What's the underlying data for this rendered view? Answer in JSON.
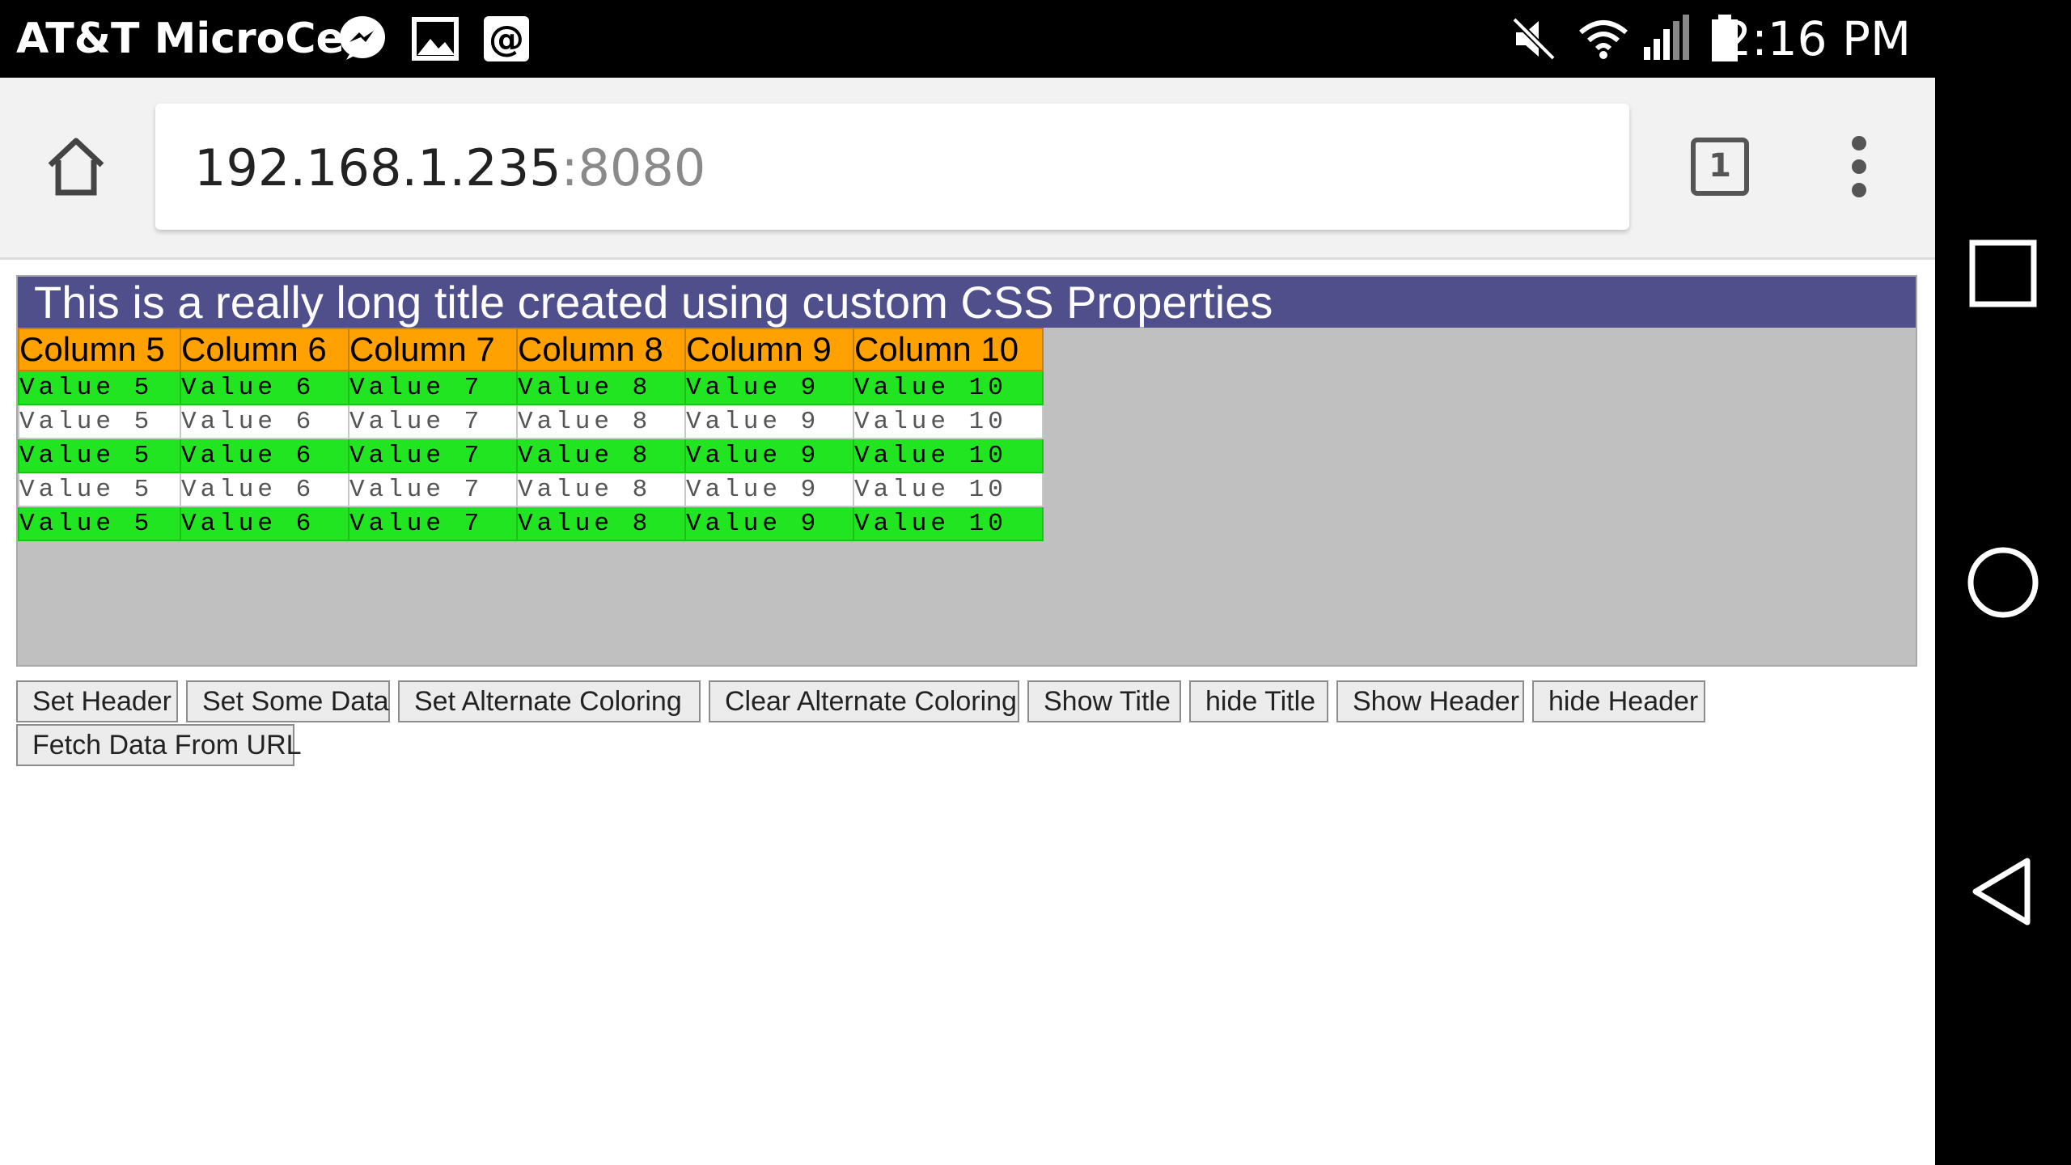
{
  "status_bar": {
    "carrier": "AT&T MicroCell",
    "notification_icons": [
      "messenger-icon",
      "image-icon",
      "at-sign-icon"
    ],
    "system_icons": [
      "mute-icon",
      "wifi-icon",
      "signal-icon",
      "battery-icon"
    ],
    "time": "2:16 PM"
  },
  "browser": {
    "url_host": "192.168.1.235",
    "url_port": ":8080",
    "tab_count": "1"
  },
  "grid": {
    "title": "This is a really long title created using custom CSS Properties",
    "columns": [
      "Column 5",
      "Column 6",
      "Column 7",
      "Column 8",
      "Column 9",
      "Column 10"
    ],
    "rows": [
      {
        "style": "green",
        "cells": [
          "Value 5",
          "Value 6",
          "Value 7",
          "Value 8",
          "Value 9",
          "Value 10"
        ]
      },
      {
        "style": "white",
        "cells": [
          "Value 5",
          "Value 6",
          "Value 7",
          "Value 8",
          "Value 9",
          "Value 10"
        ]
      },
      {
        "style": "green",
        "cells": [
          "Value 5",
          "Value 6",
          "Value 7",
          "Value 8",
          "Value 9",
          "Value 10"
        ]
      },
      {
        "style": "white",
        "cells": [
          "Value 5",
          "Value 6",
          "Value 7",
          "Value 8",
          "Value 9",
          "Value 10"
        ]
      },
      {
        "style": "green",
        "cells": [
          "Value 5",
          "Value 6",
          "Value 7",
          "Value 8",
          "Value 9",
          "Value 10"
        ]
      }
    ],
    "colors": {
      "title_bg": "#4f4f8c",
      "header_bg": "#ffa100",
      "alt_row_bg": "#22e522",
      "body_bg": "#c0c0c0"
    }
  },
  "buttons": [
    "Set Header",
    "Set Some Data",
    "Set Alternate Coloring",
    "Clear Alternate Coloring",
    "Show Title",
    "hide Title",
    "Show Header",
    "hide Header",
    "Fetch Data From URL"
  ],
  "nav_bar": [
    "recent-apps-icon",
    "home-circle-icon",
    "back-icon"
  ]
}
